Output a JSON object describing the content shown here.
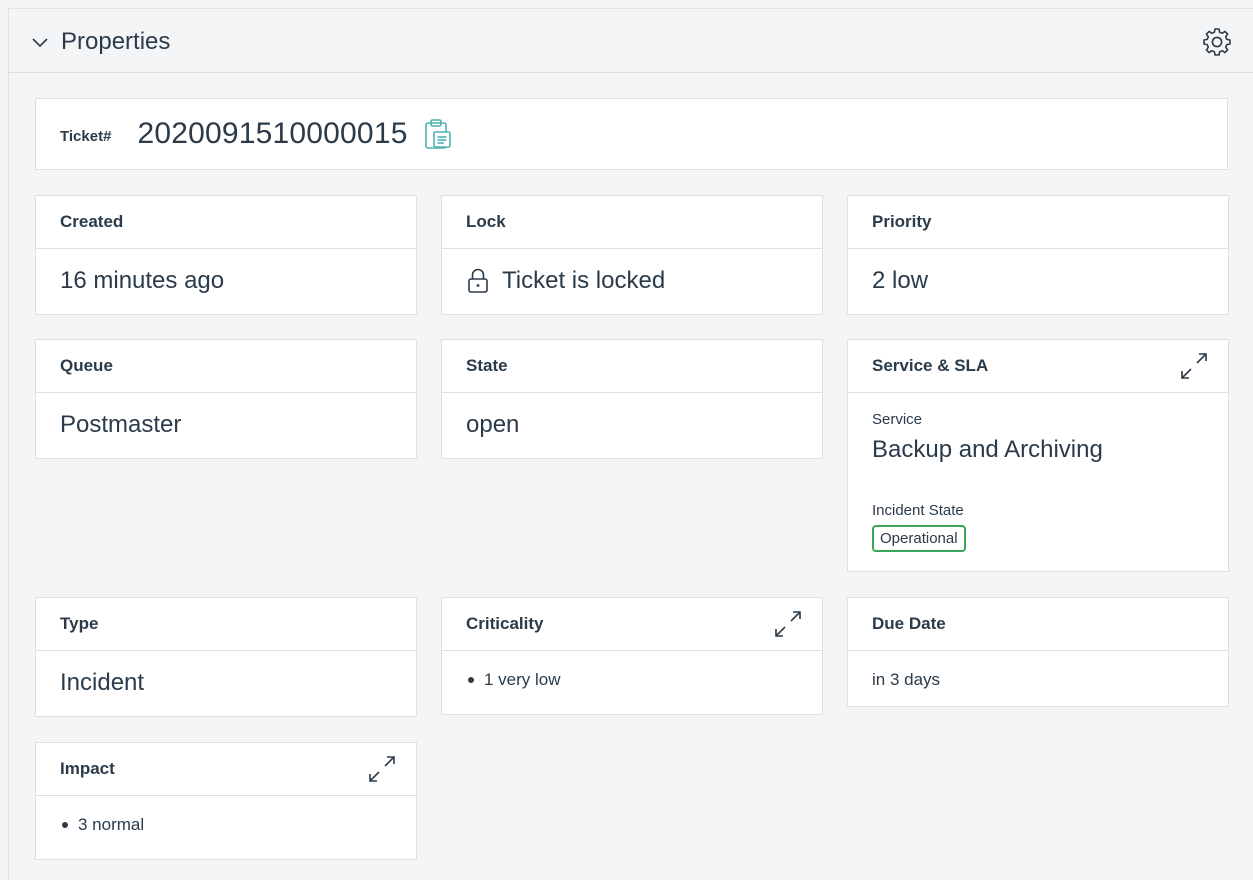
{
  "header": {
    "title": "Properties",
    "collapse_icon": "chevron-down-icon",
    "settings_icon": "gear-icon"
  },
  "ticket": {
    "label": "Ticket#",
    "number": "2020091510000015",
    "copy_icon": "clipboard-icon"
  },
  "fields": {
    "created": {
      "label": "Created",
      "value": "16 minutes ago"
    },
    "lock": {
      "label": "Lock",
      "value": "Ticket is locked",
      "icon": "lock-icon"
    },
    "priority": {
      "label": "Priority",
      "value": "2 low"
    },
    "queue": {
      "label": "Queue",
      "value": "Postmaster"
    },
    "state": {
      "label": "State",
      "value": "open"
    },
    "service_sla": {
      "label": "Service & SLA",
      "service_label": "Service",
      "service_value": "Backup and Archiving",
      "incident_label": "Incident State",
      "incident_value": "Operational"
    },
    "type": {
      "label": "Type",
      "value": "Incident"
    },
    "criticality": {
      "label": "Criticality",
      "value": "1 very low"
    },
    "due_date": {
      "label": "Due Date",
      "value": "in 3 days"
    },
    "impact": {
      "label": "Impact",
      "value": "3 normal"
    }
  },
  "colors": {
    "accent": "#4db3b0",
    "badge_border": "#3aa65a",
    "text": "#2b3b4a",
    "border": "#dde1e4"
  }
}
